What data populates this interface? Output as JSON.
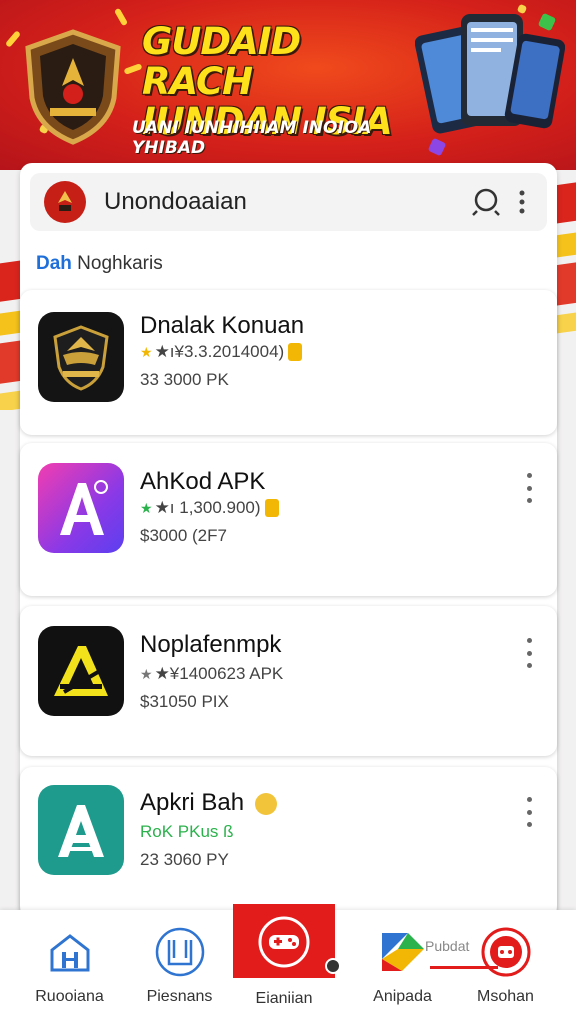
{
  "banner": {
    "title_line1": "GUDAID RACH",
    "title_line2": "IUNDAN ISIA",
    "subtitle": "UANI IUNHIHIIAM INOIOA YHIBAD"
  },
  "search": {
    "text": "Unondoaaian"
  },
  "section": {
    "label_accent": "Dah",
    "label_rest": " Noghkaris"
  },
  "apps": [
    {
      "name": "Dnalak Konuan",
      "meta": "★ı¥3.3.2014004)",
      "size": "33 3000 PK",
      "star_color": "#f2b705"
    },
    {
      "name": "AhKod APK",
      "meta": "★ı 1,300.900)",
      "size": "$3000 (2F7",
      "star_color": "#2bb24c"
    },
    {
      "name": "Noplafenmpk",
      "meta": "★¥1400623 APK",
      "size": "$31050 PIX",
      "star_color": "#777777"
    },
    {
      "name": "Apkri Bah",
      "meta": "RoK PKus ß",
      "size": "23 3060 PY",
      "star_color": "#2bb24c"
    }
  ],
  "nav": {
    "items": [
      {
        "label": "Ruooiana",
        "icon": "home-icon"
      },
      {
        "label": "Piesnans",
        "icon": "library-icon"
      },
      {
        "label": "Eianiian",
        "icon": "game-controller-icon"
      },
      {
        "label": "Anipada",
        "icon": "play-store-icon"
      },
      {
        "label": "Msohan",
        "icon": "profile-icon"
      }
    ],
    "publisher_text": "Pubdat"
  },
  "colors": {
    "brand_red": "#e21b1b",
    "banner_yellow": "#ffe11b",
    "accent_blue": "#1e6fd9"
  }
}
